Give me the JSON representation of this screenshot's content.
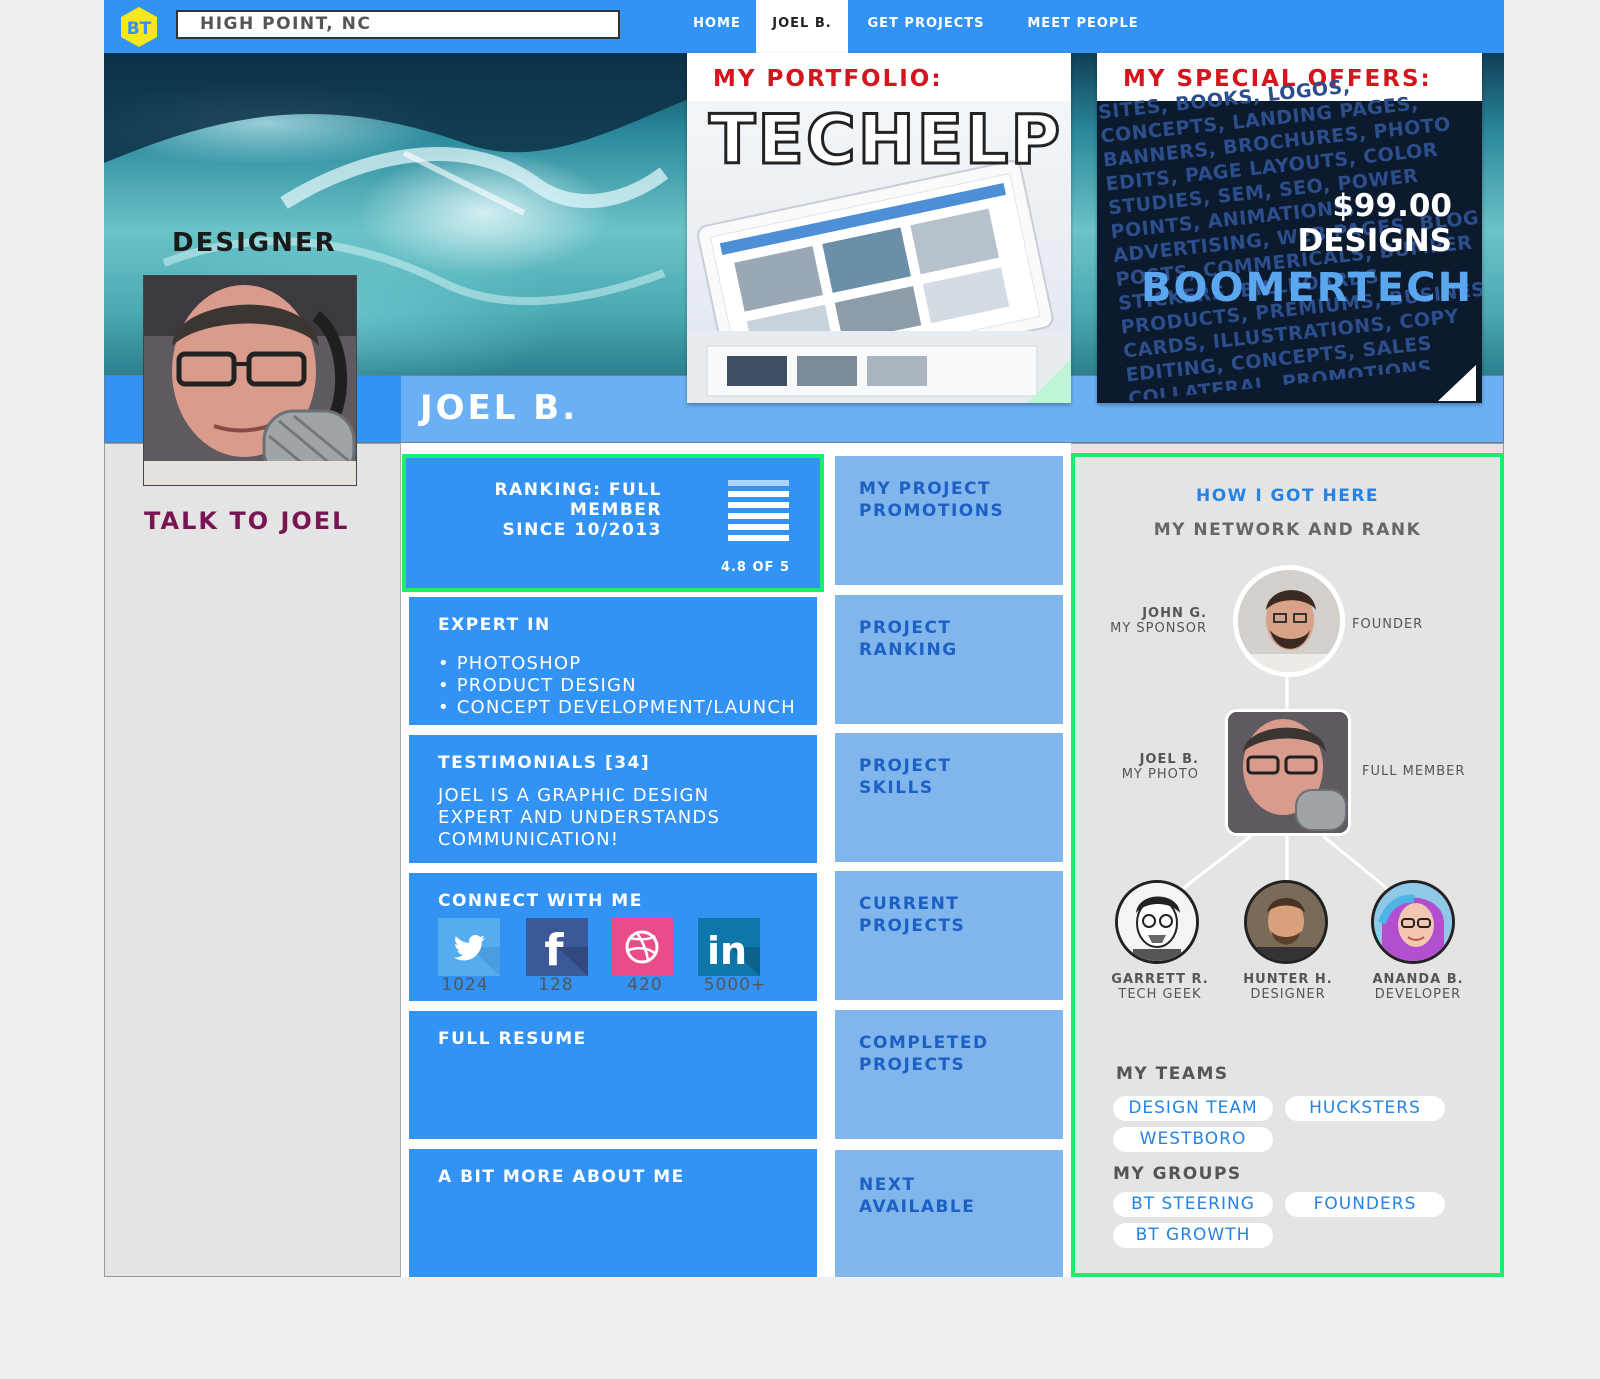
{
  "header": {
    "logo_text": "BT",
    "location": "HIGH POINT, NC",
    "nav": [
      {
        "label": "HOME"
      },
      {
        "label": "JOEL B."
      },
      {
        "label": "GET PROJECTS"
      },
      {
        "label": "MEET PEOPLE"
      }
    ],
    "active_nav": "JOEL B."
  },
  "profile": {
    "role": "DESIGNER",
    "name": "JOEL B.",
    "talk": "TALK TO JOEL"
  },
  "portfolio": {
    "title": "MY PORTFOLIO:",
    "project": "TECHELP"
  },
  "offers": {
    "title": "MY SPECIAL OFFERS:",
    "price": "$99.00",
    "item": "DESIGNS",
    "brand": "BOOMERTECH",
    "background_words": "SITES, BOOKS, LOGOS, CONCEPTS, LANDING PAGES, BANNERS, BROCHURES, PHOTO EDITS, PAGE LAYOUTS, COLOR STUDIES, SEM, SEO, POWER POINTS, ANIMATIONS, ADVERTISING, WEB PAGES, BLOG POSTS, COMMERICALS, BUMPER STICKERS, BILLBOARDS, PRODUCTS, PREMIUMS, BUSINESS CARDS, ILLUSTRATIONS, COPY EDITING, CONCEPTS, SALES COLLATERAL, PROMOTIONS, EBOOKCOVERS, MENUS, BCARDS, DISPLAYS, LOGOS, PAGE LAYOUTS, BANNERS, BROCHURES, POWER POINTS, ANIMATIONS, COLOR STUDIES, SEM, SEO, BLOG POSTS, COMMERICALS, ADVERTISING, WEB PAGES, STICKERS, BILLBOARDS, PRODUCTS, BUMPER, BOARDS, ILLUSTRATIONS, PREMIUMS"
  },
  "ranking": {
    "label_line1": "RANKING: FULL MEMBER",
    "label_line2": "SINCE 10/2013",
    "score_text": "4.8 OF 5",
    "score": 4.8,
    "max": 5
  },
  "expert": {
    "title": "EXPERT IN",
    "items": [
      "• PHOTOSHOP",
      "• PRODUCT DESIGN",
      "• CONCEPT DEVELOPMENT/LAUNCH"
    ]
  },
  "testimonials": {
    "title": "TESTIMONIALS [34]",
    "lines": [
      "JOEL IS A GRAPHIC DESIGN",
      "EXPERT AND UNDERSTANDS",
      "COMMUNICATION!"
    ]
  },
  "connect": {
    "title": "CONNECT WITH ME",
    "networks": [
      {
        "icon": "twitter-icon",
        "count": "1024",
        "color": "#55acee"
      },
      {
        "icon": "facebook-icon",
        "count": "128",
        "color": "#3b5998"
      },
      {
        "icon": "dribbble-icon",
        "count": "420",
        "color": "#ea4c89"
      },
      {
        "icon": "linkedin-icon",
        "count": "5000+",
        "color": "#0e76a8"
      }
    ]
  },
  "resume": {
    "title": "FULL RESUME"
  },
  "about": {
    "title": "A BIT MORE ABOUT ME"
  },
  "side_tiles": [
    {
      "line1": "MY PROJECT",
      "line2": "PROMOTIONS"
    },
    {
      "line1": "PROJECT",
      "line2": "RANKING"
    },
    {
      "line1": "PROJECT",
      "line2": "SKILLS"
    },
    {
      "line1": "CURRENT",
      "line2": "PROJECTS"
    },
    {
      "line1": "COMPLETED",
      "line2": "PROJECTS"
    },
    {
      "line1": "NEXT",
      "line2": "AVAILABLE"
    }
  ],
  "network": {
    "title": "HOW I GOT HERE",
    "subtitle": "MY NETWORK AND RANK",
    "sponsor": {
      "name": "JOHN G.",
      "sub": "MY SPONSOR",
      "rank": "FOUNDER"
    },
    "me": {
      "name": "JOEL B.",
      "sub": "MY PHOTO",
      "rank": "FULL MEMBER"
    },
    "children": [
      {
        "name": "GARRETT R.",
        "role": "TECH GEEK"
      },
      {
        "name": "HUNTER H.",
        "role": "DESIGNER"
      },
      {
        "name": "ANANDA B.",
        "role": "DEVELOPER"
      }
    ]
  },
  "teams": {
    "title": "MY TEAMS",
    "items": [
      "DESIGN TEAM",
      "HUCKSTERS",
      "WESTBORO"
    ]
  },
  "groups": {
    "title": "MY GROUPS",
    "items": [
      "BT STEERING",
      "FOUNDERS",
      "BT GROWTH"
    ]
  },
  "colors": {
    "primary_blue": "#3393f5",
    "light_blue": "#80b6ec",
    "highlight_green": "#19ee6e",
    "offer_red": "#d4151b",
    "talk_purple": "#7a1553"
  }
}
